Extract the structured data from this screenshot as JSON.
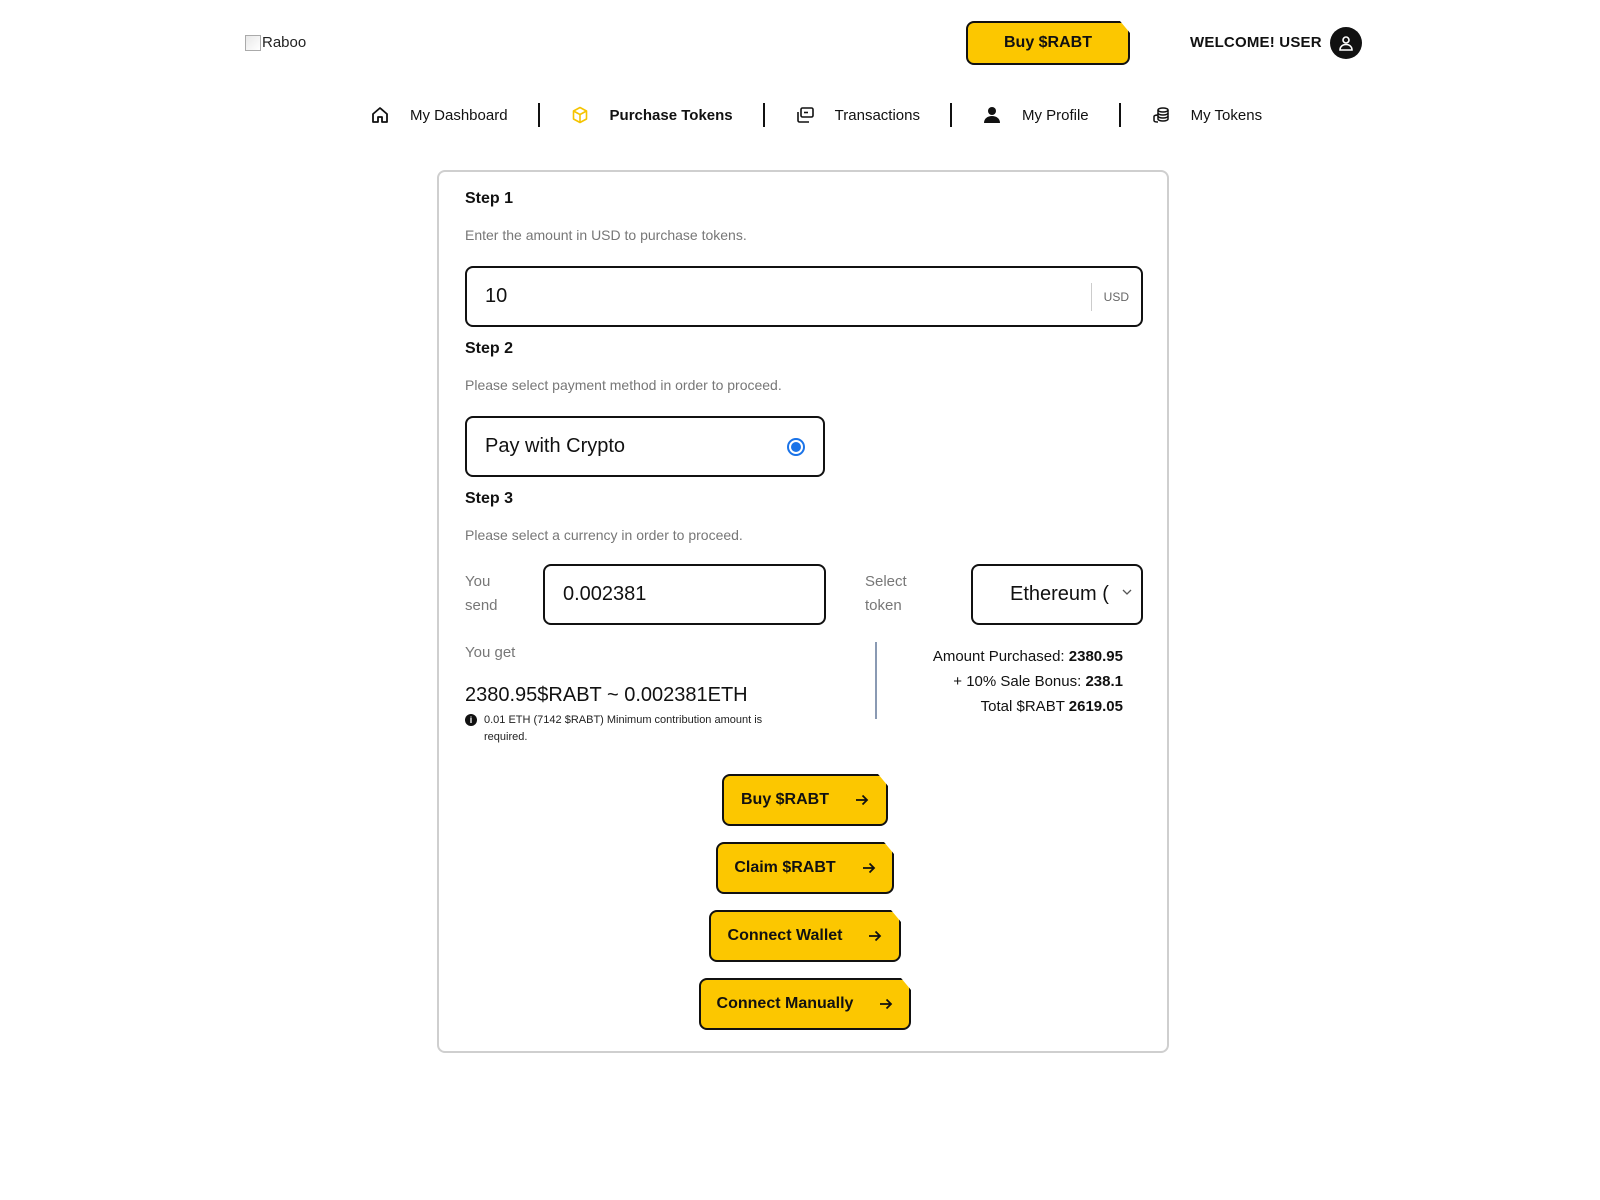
{
  "header": {
    "logo_alt": "Raboo",
    "buy_button": "Buy $RABT",
    "welcome": "WELCOME! USER"
  },
  "nav": {
    "items": [
      {
        "label": "My Dashboard",
        "icon": "home-icon"
      },
      {
        "label": "Purchase Tokens",
        "icon": "cube-icon",
        "active": true
      },
      {
        "label": "Transactions",
        "icon": "transactions-icon"
      },
      {
        "label": "My Profile",
        "icon": "user-icon"
      },
      {
        "label": "My Tokens",
        "icon": "coins-icon"
      }
    ]
  },
  "step1": {
    "title": "Step 1",
    "desc": "Enter the amount in USD to purchase tokens.",
    "amount": "10",
    "unit": "USD"
  },
  "step2": {
    "title": "Step 2",
    "desc": "Please select payment method in order to proceed.",
    "option": "Pay with Crypto"
  },
  "step3": {
    "title": "Step 3",
    "desc": "Please select a currency in order to proceed.",
    "you_send_line1": "You",
    "you_send_line2": "send",
    "send_value": "0.002381",
    "select_token_line1": "Select",
    "select_token_line2": "token",
    "token_value": "Ethereum (ETH)",
    "you_get_label": "You get",
    "you_get_value": "2380.95$RABT  ~  0.002381ETH",
    "min_note": "0.01 ETH (7142 $RABT) Minimum contribution amount is required."
  },
  "summary": {
    "purchased_label": "Amount Purchased:",
    "purchased_value": "2380.95",
    "bonus_label": "+ 10% Sale Bonus:",
    "bonus_value": "238.1",
    "total_label": "Total $RABT",
    "total_value": "2619.05"
  },
  "actions": {
    "buy": "Buy $RABT",
    "claim": "Claim $RABT",
    "connect_wallet": "Connect Wallet",
    "connect_manually": "Connect Manually"
  },
  "colors": {
    "accent": "#fcc700",
    "radio": "#1a73e8"
  }
}
